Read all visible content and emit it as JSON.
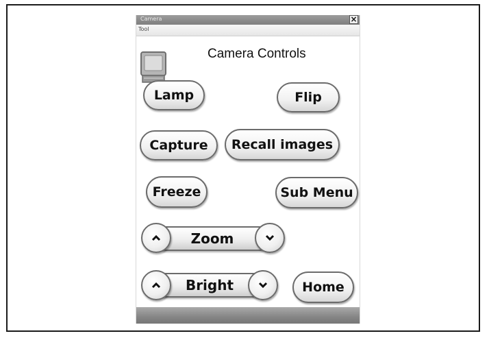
{
  "window": {
    "title": "Camera",
    "menu_tab": "Tool",
    "close_glyph": "×"
  },
  "heading": "Camera Controls",
  "icons": {
    "camera": "camera-icon",
    "zoom_up": "chevron-up-icon",
    "zoom_down": "chevron-down-icon",
    "bright_up": "chevron-up-icon",
    "bright_down": "chevron-down-icon"
  },
  "buttons": {
    "lamp": "Lamp",
    "flip": "Flip",
    "capture": "Capture",
    "recall": "Recall images",
    "freeze": "Freeze",
    "sub_menu": "Sub Menu",
    "home": "Home"
  },
  "controls": {
    "zoom": "Zoom",
    "bright": "Bright"
  }
}
